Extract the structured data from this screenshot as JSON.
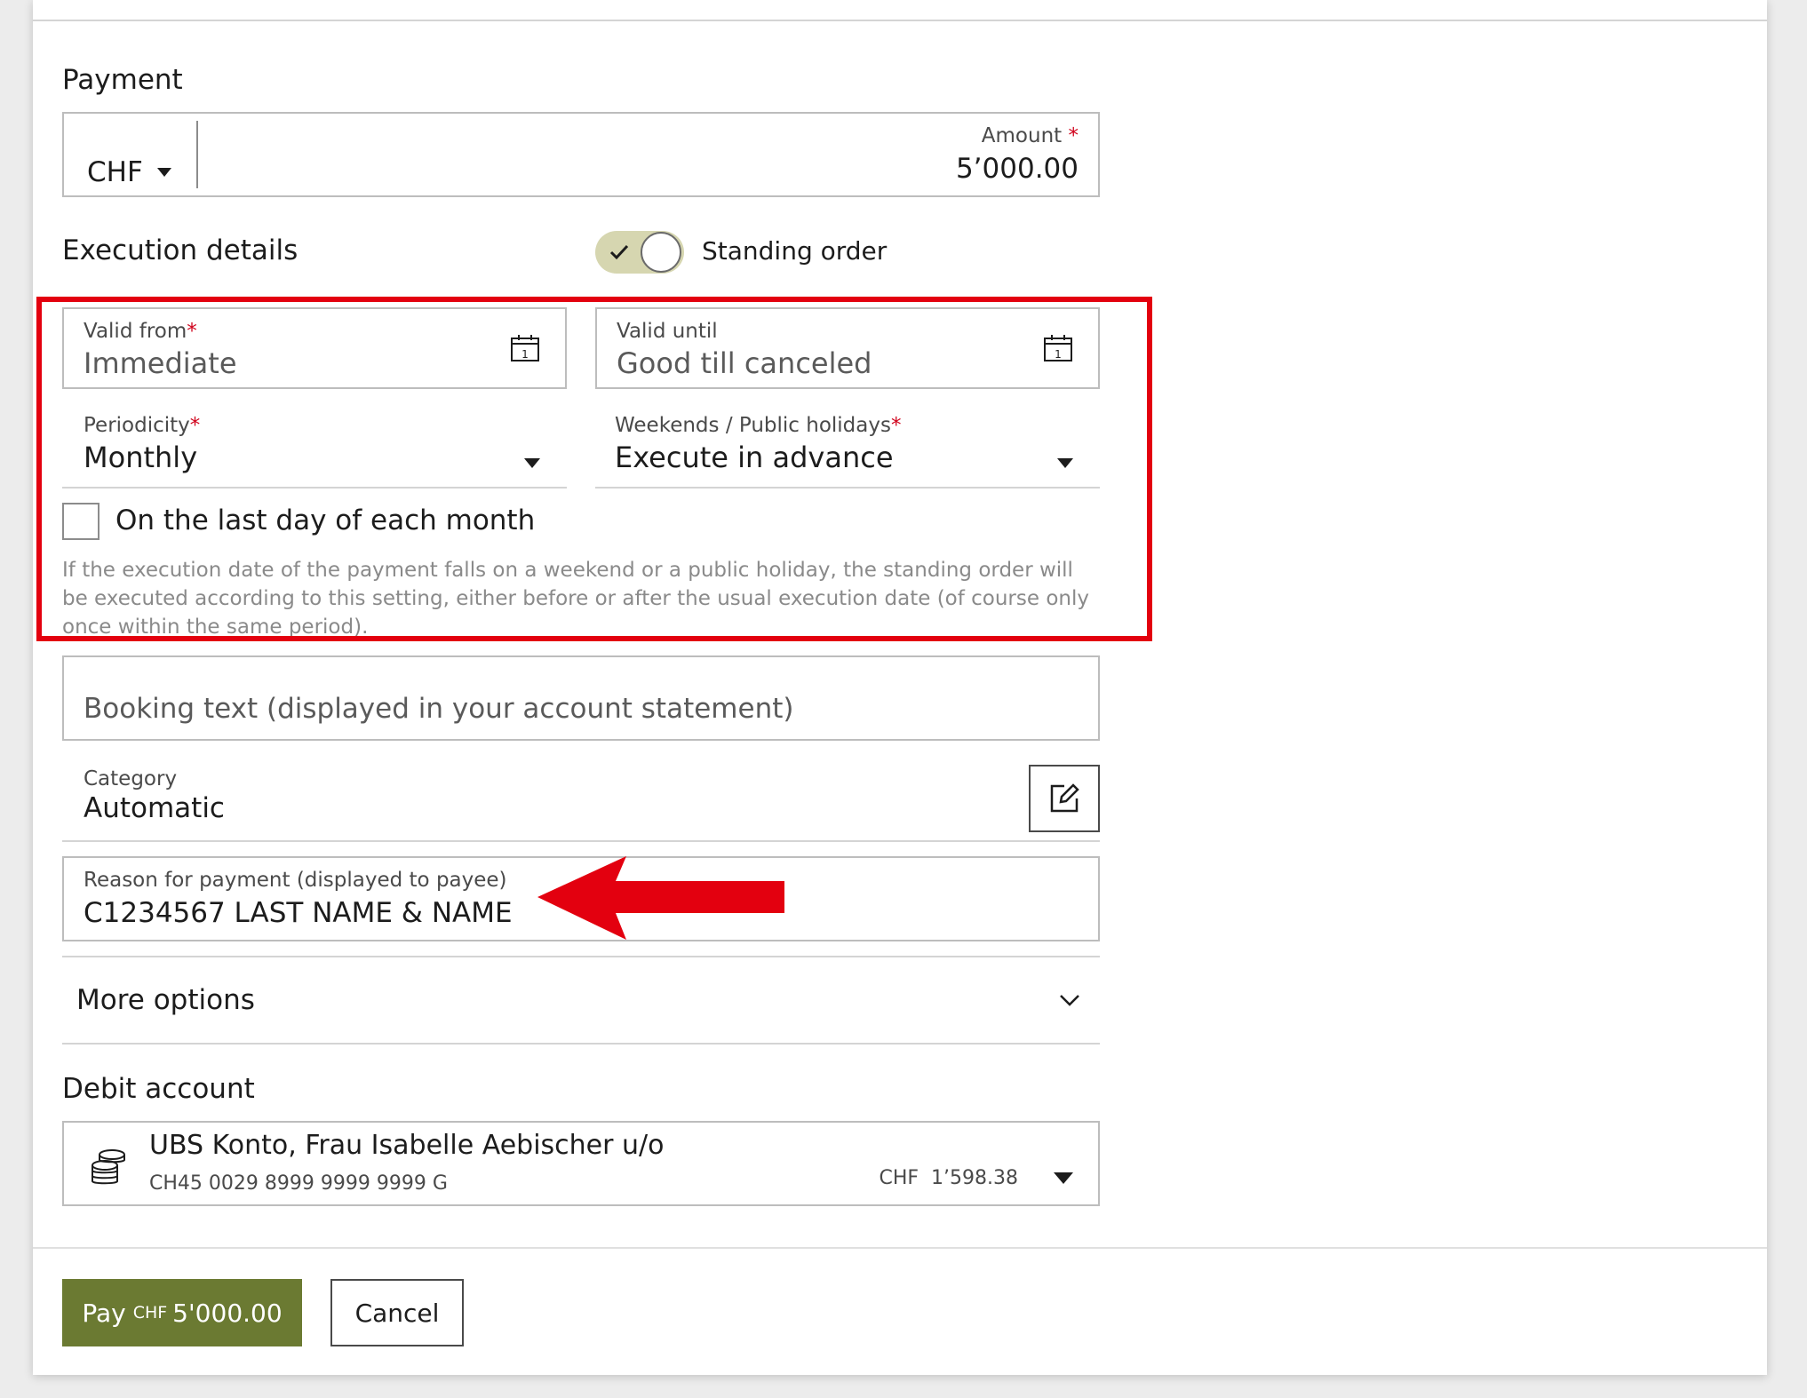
{
  "payment": {
    "section_title": "Payment",
    "currency": "CHF",
    "amount_label": "Amount",
    "amount_required": "*",
    "amount_value": "5’000.00"
  },
  "execution": {
    "section_title": "Execution details",
    "standing_order_label": "Standing order",
    "standing_order_on": true,
    "valid_from_label": "Valid from",
    "valid_from_required": "*",
    "valid_from_value": "Immediate",
    "valid_until_label": "Valid until",
    "valid_until_value": "Good till canceled",
    "periodicity_label": "Periodicity",
    "periodicity_required": "*",
    "periodicity_value": "Monthly",
    "weekends_label": "Weekends / Public holidays",
    "weekends_required": "*",
    "weekends_value": "Execute in advance",
    "last_day_label": "On the last day of each month",
    "last_day_checked": false,
    "hint": "If the execution date of the payment falls on a weekend or a public holiday, the standing order will be executed according to this setting, either before or after the usual execution date (of course only once within the same period)."
  },
  "booking": {
    "placeholder": "Booking text (displayed in your account statement)"
  },
  "category": {
    "label": "Category",
    "value": "Automatic"
  },
  "reason": {
    "label": "Reason for payment (displayed to payee)",
    "value": "C1234567  LAST NAME & NAME"
  },
  "more_options": {
    "label": "More options"
  },
  "debit": {
    "section_title": "Debit account",
    "account_name": "UBS Konto, Frau Isabelle Aebischer u/o",
    "iban": "CH45 0029 8999 9999 9999 G",
    "balance_currency": "CHF",
    "balance": "1’598.38"
  },
  "actions": {
    "pay_prefix": "Pay",
    "pay_currency": "CHF",
    "pay_amount": "5'000.00",
    "cancel_label": "Cancel"
  },
  "colors": {
    "annotation_red": "#e3000f",
    "primary_button": "#6b7a32",
    "toggle_track": "#d6d6b0"
  },
  "icons": {
    "calendar": "calendar-icon",
    "currency_dropdown": "caret-down-icon",
    "edit": "edit-icon",
    "chevron": "chevron-down-icon",
    "coins": "coins-icon",
    "check": "check-icon",
    "arrow": "red-arrow-annotation"
  }
}
